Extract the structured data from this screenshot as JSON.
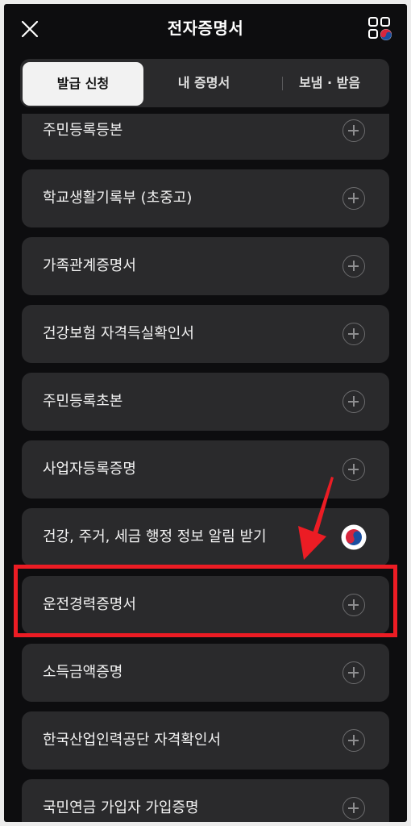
{
  "header": {
    "title": "전자증명서",
    "close_icon": "close-icon",
    "grid_icon": "grid-menu-icon"
  },
  "tabs": [
    {
      "label": "발급 신청",
      "active": true
    },
    {
      "label": "내 증명서",
      "active": false
    },
    {
      "label": "보냄 · 받음",
      "active": false
    }
  ],
  "items": [
    {
      "label": "주민등록등본",
      "icon": "plus-circle-icon"
    },
    {
      "label": "학교생활기록부 (초중고)",
      "icon": "plus-circle-icon"
    },
    {
      "label": "가족관계증명서",
      "icon": "plus-circle-icon"
    },
    {
      "label": "건강보험 자격득실확인서",
      "icon": "plus-circle-icon"
    },
    {
      "label": "주민등록초본",
      "icon": "plus-circle-icon"
    },
    {
      "label": "사업자등록증명",
      "icon": "plus-circle-icon"
    },
    {
      "label": "건강, 주거, 세금 행정 정보 알림 받기",
      "icon": "taegeuk-icon"
    },
    {
      "label": "운전경력증명서",
      "icon": "plus-circle-icon",
      "highlighted": true
    },
    {
      "label": "소득금액증명",
      "icon": "plus-circle-icon"
    },
    {
      "label": "한국산업인력공단 자격확인서",
      "icon": "plus-circle-icon"
    },
    {
      "label": "국민연금 가입자 가입증명",
      "icon": "plus-circle-icon"
    }
  ],
  "colors": {
    "background": "#0d0d0f",
    "card": "#2a2a2c",
    "highlight": "#ec1c24"
  }
}
